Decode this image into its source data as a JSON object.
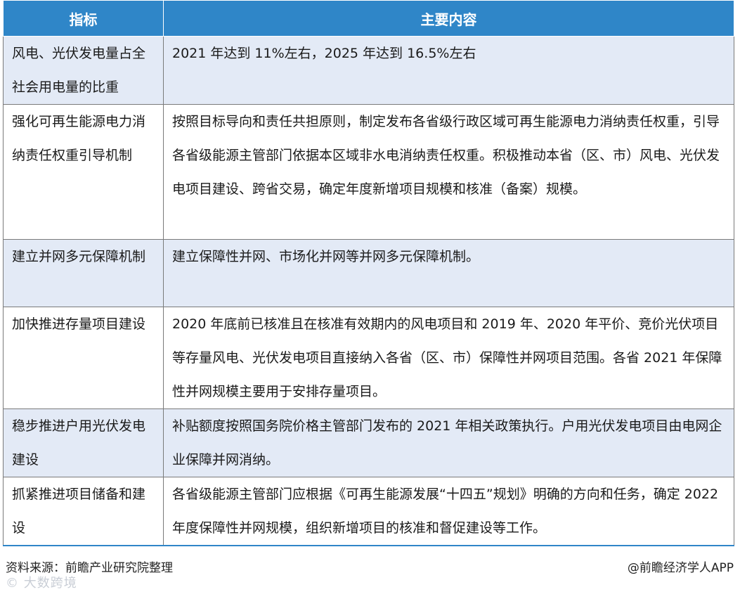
{
  "table": {
    "headers": [
      "指标",
      "主要内容"
    ],
    "rows": [
      {
        "indicator": "风电、光伏发电量占全社会用电量的比重",
        "content": "2021 年达到 11%左右，2025 年达到 16.5%左右"
      },
      {
        "indicator": "强化可再生能源电力消纳责任权重引导机制",
        "content": "按照目标导向和责任共担原则，制定发布各省级行政区域可再生能源电力消纳责任权重，引导各省级能源主管部门依据本区域非水电消纳责任权重。积极推动本省（区、市）风电、光伏发电项目建设、跨省交易，确定年度新增项目规模和核准（备案）规模。"
      },
      {
        "indicator": "建立并网多元保障机制",
        "content": "建立保障性并网、市场化并网等并网多元保障机制。"
      },
      {
        "indicator": "加快推进存量项目建设",
        "content": "2020 年底前已核准且在核准有效期内的风电项目和 2019 年、2020 年平价、竞价光伏项目等存量风电、光伏发电项目直接纳入各省（区、市）保障性并网项目范围。各省 2021 年保障性并网规模主要用于安排存量项目。"
      },
      {
        "indicator": "稳步推进户用光伏发电建设",
        "content": "补贴额度按照国务院价格主管部门发布的 2021 年相关政策执行。户用光伏发电项目由电网企业保障并网消纳。"
      },
      {
        "indicator": "抓紧推进项目储备和建设",
        "content": "各省级能源主管部门应根据《可再生能源发展“十四五”规划》明确的方向和任务，确定 2022 年度保障性并网规模，组织新增项目的核准和督促建设等工作。"
      }
    ]
  },
  "footer": {
    "source": "资料来源：前瞻产业研究院整理",
    "credit": "@前瞻经济学人APP",
    "watermark": "© 大数跨境"
  }
}
